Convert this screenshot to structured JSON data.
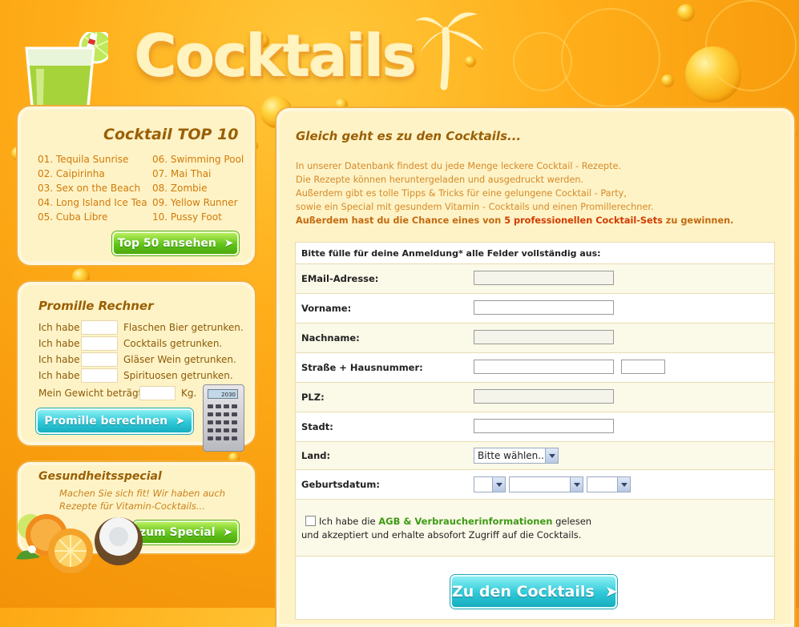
{
  "header": {
    "logo_text": "Cocktails"
  },
  "top10": {
    "title": "Cocktail TOP 10",
    "left": [
      "01. Tequila Sunrise",
      "02. Caipirinha",
      "03. Sex on the Beach",
      "04. Long Island Ice Tea",
      "05. Cuba Libre"
    ],
    "right": [
      "06. Swimming Pool",
      "07. Mai Thai",
      "08. Zombie",
      "09. Yellow Runner",
      "10. Pussy Foot"
    ],
    "button_label": "Top 50 ansehen"
  },
  "promille": {
    "title": "Promille Rechner",
    "rows": [
      {
        "prefix": "Ich habe",
        "suffix": "Flaschen Bier getrunken."
      },
      {
        "prefix": "Ich habe",
        "suffix": "Cocktails getrunken."
      },
      {
        "prefix": "Ich habe",
        "suffix": "Gläser Wein getrunken."
      },
      {
        "prefix": "Ich habe",
        "suffix": "Spirituosen getrunken."
      }
    ],
    "weight_label": "Mein Gewicht beträgt",
    "weight_unit": "Kg.",
    "calculator_display": "2030",
    "button_label": "Promille berechnen"
  },
  "health": {
    "title": "Gesundheitsspecial",
    "text_line1": "Machen Sie sich fit! Wir haben auch",
    "text_line2": "Rezepte für Vitamin-Cocktails...",
    "button_label": "zum Special"
  },
  "main": {
    "heading": "Gleich geht es zu den Cocktails...",
    "intro": [
      "In unserer Datenbank findest du jede Menge leckere Cocktail - Rezepte.",
      "Die Rezepte können heruntergeladen und ausgedruckt werden.",
      "Außerdem gibt es tolle Tipps & Tricks für eine gelungene Cocktail - Party,",
      "sowie ein Special mit gesundem Vitamin - Cocktails und einen Promillerechner."
    ],
    "intro_last_pre": "Außerdem hast du die Chance eines von ",
    "intro_last_em": "5 professionellen Cocktail-Sets",
    "intro_last_post": " zu gewinnen."
  },
  "form": {
    "instruction": "Bitte fülle für deine Anmeldung* alle Felder vollständig aus:",
    "email_label": "EMail-Adresse:",
    "vorname_label": "Vorname:",
    "nachname_label": "Nachname:",
    "strasse_label": "Straße + Hausnummer:",
    "plz_label": "PLZ:",
    "stadt_label": "Stadt:",
    "land_label": "Land:",
    "land_selected": "Bitte wählen...",
    "geburtsdatum_label": "Geburtsdatum:",
    "agb_pre": "Ich habe die ",
    "agb_link": "AGB & Verbraucherinformationen",
    "agb_post": " gelesen",
    "agb_line2": "und akzeptiert und erhalte absofort Zugriff auf die Cocktails.",
    "submit_label": "Zu den Cocktails"
  },
  "colors": {
    "orange": "#f79a0c",
    "panel": "#fef3c6",
    "green": "#62c41a",
    "teal": "#2ec8d8"
  }
}
